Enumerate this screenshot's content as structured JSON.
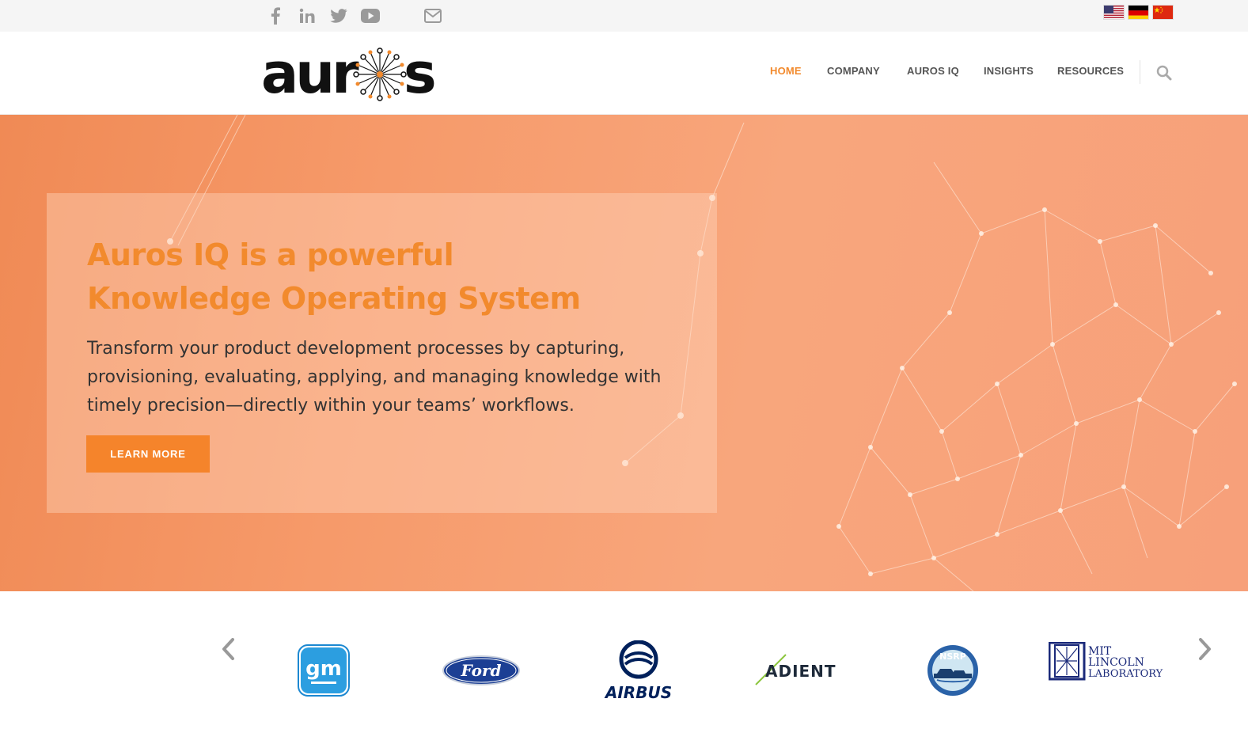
{
  "topbar": {
    "social": [
      {
        "name": "facebook-icon"
      },
      {
        "name": "linkedin-icon"
      },
      {
        "name": "twitter-icon"
      },
      {
        "name": "youtube-icon"
      },
      {
        "name": "email-icon"
      }
    ],
    "flags": [
      "us-flag",
      "germany-flag",
      "china-flag"
    ]
  },
  "header": {
    "logo_text": "auros",
    "nav": [
      "HOME",
      "COMPANY",
      "AUROS IQ",
      "INSIGHTS",
      "RESOURCES"
    ],
    "active_nav": "HOME",
    "search_icon": "search-icon"
  },
  "hero": {
    "title_line1": "Auros IQ is a powerful",
    "title_line2": "Knowledge Operating System",
    "subtitle": "Transform your product development processes by capturing, provisioning, evaluating, applying, and managing knowledge with timely precision—directly within your teams’ workflows.",
    "button": "LEARN MORE"
  },
  "clients": {
    "logos": [
      "GM",
      "Ford",
      "AIRBUS",
      "ADIENT",
      "NSRP",
      "MIT LINCOLN LABORATORY"
    ],
    "gm": "gm",
    "ford": "Ford",
    "airbus": "AIRBUS",
    "adient": "ADIENT",
    "nsrp": "NSRP",
    "mit_line1": "MIT",
    "mit_line2": "LINCOLN",
    "mit_line3": "LABORATORY"
  },
  "colors": {
    "accent": "#f28a2d",
    "button": "#f5842b",
    "nav_text": "#555555",
    "hero_bg": "#f69a6a"
  }
}
